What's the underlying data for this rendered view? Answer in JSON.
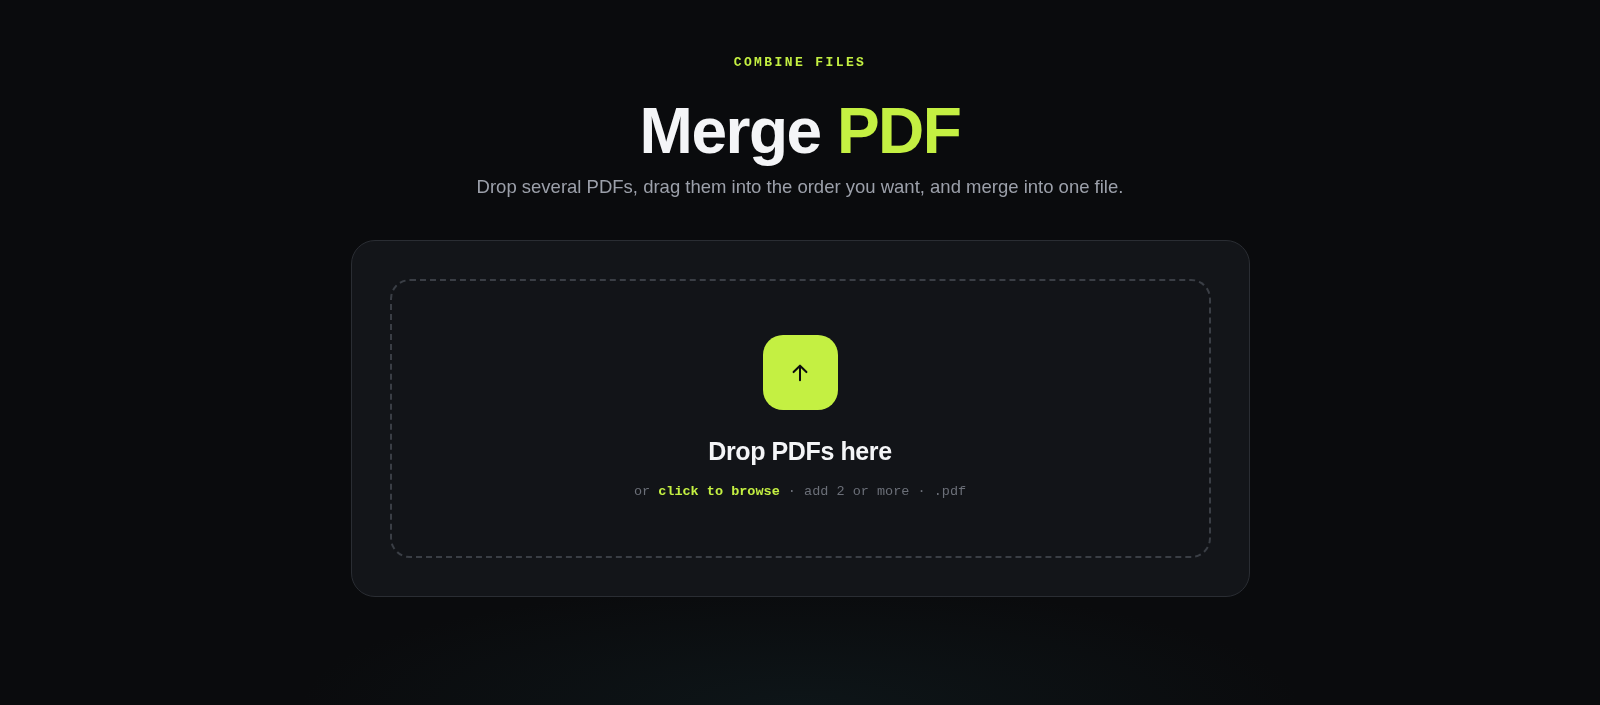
{
  "header": {
    "eyebrow": "COMBINE FILES",
    "title": "Merge",
    "title_highlight": "PDF",
    "subtitle": "Drop several PDFs, drag them into the order you want, and merge into one file."
  },
  "dropzone": {
    "title": "Drop PDFs here",
    "hint_prefix": "or",
    "hint_link": "click to browse",
    "hint_suffix": "· add 2 or more · .pdf"
  }
}
